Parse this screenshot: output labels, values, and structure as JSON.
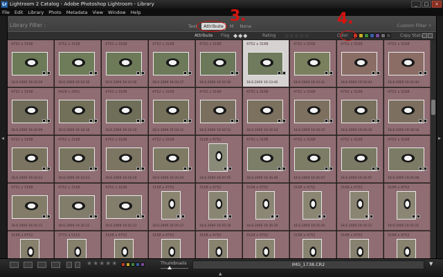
{
  "window": {
    "title": "Lightroom 2 Catalog - Adobe Photoshop Lightroom - Library",
    "app_icon": "Lr",
    "buttons": {
      "minimize": "_",
      "maximize": "□",
      "close": "×"
    }
  },
  "menu": [
    "File",
    "Edit",
    "Library",
    "Photo",
    "Metadata",
    "View",
    "Window",
    "Help"
  ],
  "filter_bar": {
    "title": "Library Filter :",
    "tabs": [
      "Text",
      "Attribute",
      "M",
      "None"
    ],
    "active_tab": "Attribute",
    "custom_filter": "Custom Filter ÷",
    "attribute_row": {
      "attribute_label": "Attribute",
      "flag_label": "Flag",
      "flag_icons": "◆◆◆",
      "rating_label": "Rating",
      "rating_stars": "☆☆☆☆☆",
      "color_label": "Color",
      "color_swatches": [
        "#c43c2f",
        "#c7b02a",
        "#3f8a3f",
        "#3a5fa8",
        "#7a4a9c",
        "#6e6e6e",
        "#444444"
      ],
      "copy_status_label": "Copy Status"
    }
  },
  "annotations": {
    "step3": "3.",
    "step4": "4."
  },
  "grid": {
    "columns": 9,
    "rows": [
      [
        {
          "dims": "4752 x 3168",
          "date": "18.6.2009 19:33:29",
          "orient": "land",
          "tint": "#6c7a58"
        },
        {
          "dims": "4752 x 3168",
          "date": "18.6.2009 19:33:30",
          "orient": "land",
          "tint": "#6f7c59"
        },
        {
          "dims": "4752 x 3168",
          "date": "18.6.2009 19:33:30",
          "orient": "land",
          "tint": "#6c7a58"
        },
        {
          "dims": "4752 x 3168",
          "date": "18.6.2009 19:33:37",
          "orient": "land",
          "tint": "#6d7a5a"
        },
        {
          "dims": "4752 x 3168",
          "date": "18.6.2009 19:33:39",
          "orient": "land",
          "tint": "#6b785a"
        },
        {
          "dims": "4752 x 3168",
          "date": "18.6.2009 19:33:40",
          "orient": "land",
          "tint": "#6f7b5c",
          "selected": true
        },
        {
          "dims": "4752 x 3168",
          "date": "18.6.2009 19:33:41",
          "orient": "land",
          "tint": "#7a7f5e"
        },
        {
          "dims": "4752 x 3168",
          "date": "18.6.2009 19:33:43",
          "orient": "land",
          "tint": "#8a6e66"
        },
        {
          "dims": "4752 x 3168",
          "date": "18.6.2009 19:33:44",
          "orient": "land",
          "tint": "#8b6d66"
        }
      ],
      [
        {
          "dims": "4752 x 3168",
          "date": "18.6.2009 19:34:09",
          "orient": "land",
          "tint": "#6e6c58"
        },
        {
          "dims": "4428 x 2951",
          "date": "18.6.2009 19:34:10",
          "orient": "land",
          "tint": "#727058"
        },
        {
          "dims": "4752 x 3168",
          "date": "18.6.2009 19:34:10",
          "orient": "land",
          "tint": "#6f6e58"
        },
        {
          "dims": "4752 x 3168",
          "date": "18.6.2009 19:34:11",
          "orient": "land",
          "tint": "#76715a"
        },
        {
          "dims": "4752 x 3168",
          "date": "18.6.2009 19:34:13",
          "orient": "land",
          "tint": "#7a6f5e"
        },
        {
          "dims": "4752 x 3168",
          "date": "18.6.2009 19:34:14",
          "orient": "land",
          "tint": "#7c715e"
        },
        {
          "dims": "4752 x 3168",
          "date": "18.6.2009 19:34:15",
          "orient": "land",
          "tint": "#7d705f"
        },
        {
          "dims": "4752 x 3168",
          "date": "18.6.2009 19:34:16",
          "orient": "land",
          "tint": "#7a705e"
        },
        {
          "dims": "4752 x 3168",
          "date": "18.6.2009 19:34:16",
          "orient": "land",
          "tint": "#7c6f5f"
        }
      ],
      [
        {
          "dims": "4752 x 3168",
          "date": "18.6.2009 19:34:23",
          "orient": "land",
          "tint": "#7b7460"
        },
        {
          "dims": "4752 x 3168",
          "date": "18.6.2009 19:34:23",
          "orient": "land",
          "tint": "#7a7560"
        },
        {
          "dims": "4752 x 3168",
          "date": "18.6.2009 19:34:24",
          "orient": "land",
          "tint": "#7c7562"
        },
        {
          "dims": "4752 x 3168",
          "date": "18.6.2009 19:35:04",
          "orient": "land",
          "tint": "#7f7a64"
        },
        {
          "dims": "3168 x 4752",
          "date": "18.6.2009 19:35:05",
          "orient": "port",
          "tint": "#8a8a78"
        },
        {
          "dims": "4752 x 3168",
          "date": "18.6.2009 19:35:06",
          "orient": "land",
          "tint": "#7c7e68"
        },
        {
          "dims": "4752 x 3168",
          "date": "18.6.2009 19:35:07",
          "orient": "land",
          "tint": "#7d7d66"
        },
        {
          "dims": "4752 x 3168",
          "date": "18.6.2009 19:35:07",
          "orient": "land",
          "tint": "#7b7a64"
        },
        {
          "dims": "4752 x 3168",
          "date": "18.6.2009 19:35:08",
          "orient": "land",
          "tint": "#7c7b65"
        }
      ],
      [
        {
          "dims": "4752 x 3168",
          "date": "18.6.2009 19:35:11",
          "orient": "land",
          "tint": "#827c68"
        },
        {
          "dims": "4752 x 3168",
          "date": "18.6.2009 19:35:12",
          "orient": "land",
          "tint": "#827d6a"
        },
        {
          "dims": "4752 x 3168",
          "date": "18.6.2009 19:35:13",
          "orient": "land",
          "tint": "#837d6b"
        },
        {
          "dims": "3168 x 4752",
          "date": "18.6.2009 19:35:17",
          "orient": "port",
          "tint": "#8a8470"
        },
        {
          "dims": "3168 x 4752",
          "date": "18.6.2009 19:35:18",
          "orient": "port",
          "tint": "#888672"
        },
        {
          "dims": "3168 x 4752",
          "date": "18.6.2009 19:35:19",
          "orient": "port",
          "tint": "#8b8774"
        },
        {
          "dims": "3168 x 4752",
          "date": "18.6.2009 19:35:20",
          "orient": "port",
          "tint": "#8a8672"
        },
        {
          "dims": "3168 x 4752",
          "date": "18.6.2009 19:35:21",
          "orient": "port",
          "tint": "#898572"
        },
        {
          "dims": "3168 x 4752",
          "date": "18.6.2009 19:35:22",
          "orient": "port",
          "tint": "#8a8673"
        }
      ],
      [
        {
          "dims": "3168 x 4752",
          "date": "",
          "orient": "port",
          "tint": "#86806c"
        },
        {
          "dims": "3772 x 5151",
          "date": "",
          "orient": "port",
          "tint": "#85806c"
        },
        {
          "dims": "3168 x 4752",
          "date": "",
          "orient": "port",
          "tint": "#86816d"
        },
        {
          "dims": "3168 x 4752",
          "date": "",
          "orient": "port",
          "tint": "#87826e"
        },
        {
          "dims": "3168 x 4752",
          "date": "",
          "orient": "port",
          "tint": "#88836f"
        },
        {
          "dims": "3168 x 4752",
          "date": "",
          "orient": "port",
          "tint": "#888470"
        },
        {
          "dims": "3168 x 4752",
          "date": "",
          "orient": "port",
          "tint": "#878370"
        },
        {
          "dims": "3168 x 4752",
          "date": "",
          "orient": "port",
          "tint": "#86826f"
        },
        {
          "dims": "3168 x 4752",
          "date": "",
          "orient": "port",
          "tint": "#87836f"
        }
      ]
    ]
  },
  "toolbar": {
    "view_buttons": [
      "grid-view",
      "loupe-view",
      "compare-view",
      "survey-view"
    ],
    "rating_stars": "★★★★★",
    "color_swatches": [
      "#c43c2f",
      "#c7b02a",
      "#3f8a3f",
      "#3a5fa8",
      "#7a4a9c"
    ],
    "thumbnails_label": "Thumbnails",
    "filename": "IMG_1738.CR2"
  }
}
